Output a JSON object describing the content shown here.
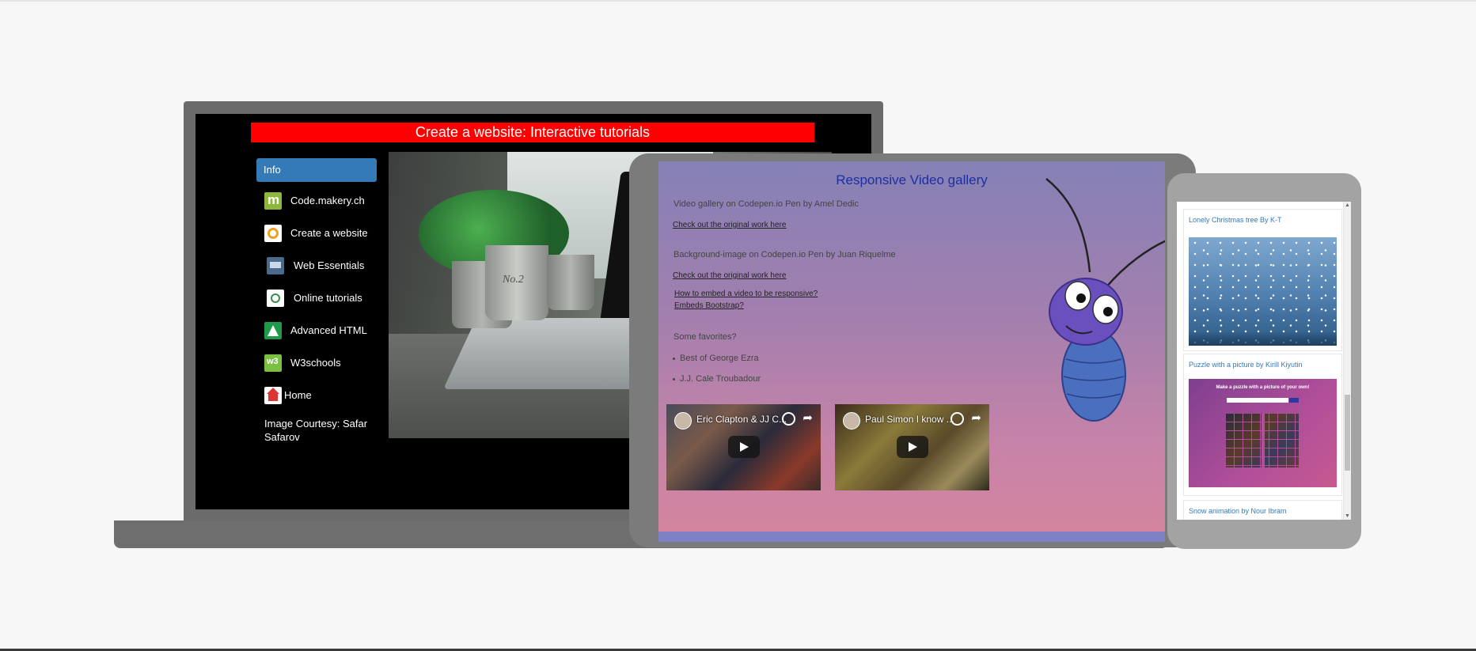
{
  "laptop": {
    "site_title": "Create a website: Interactive tutorials",
    "nav": {
      "info_label": "Info",
      "items": [
        {
          "label": "Code.makery.ch",
          "icon": "codemakery-icon"
        },
        {
          "label": "Create a website",
          "icon": "create-website-icon"
        },
        {
          "label": "Web Essentials",
          "icon": "web-essentials-icon"
        },
        {
          "label": "Online tutorials",
          "icon": "online-tutorials-icon"
        },
        {
          "label": "Advanced HTML",
          "icon": "advanced-html-icon"
        },
        {
          "label": "W3schools",
          "icon": "w3schools-icon"
        },
        {
          "label": "Home",
          "icon": "home-icon"
        }
      ],
      "courtesy": "Image Courtesy: Safar Safarov"
    },
    "hero": {
      "pot_text": "No.2"
    },
    "colors": {
      "title_bar": "#ff0000",
      "info_button": "#337ab7"
    }
  },
  "tablet": {
    "title": "Responsive Video gallery",
    "text1": "Video gallery on Codepen.io Pen by Amel Dedic",
    "link1": "Check out the original work here",
    "text2": "Background-image on Codepen.io Pen by Juan Riquelme",
    "link2": "Check out the original work here",
    "link3": "How to embed a video to be responsive?",
    "link4": "Embeds Bootstrap?",
    "favorites_heading": "Some favorites?",
    "favorites": [
      "Best of George Ezra",
      "J.J. Cale Troubadour"
    ],
    "videos": [
      {
        "title": "Eric Clapton & JJ C..."
      },
      {
        "title": "Paul Simon I know ..."
      }
    ]
  },
  "phone": {
    "cards": [
      {
        "title": "Lonely Christmas tree By K-T"
      },
      {
        "title": "Puzzle with a picture by Kirill Kiyutin",
        "image_heading": "Make a puzzle with a picture of your own!"
      },
      {
        "title": "Snow animation by Nour Ibram"
      }
    ]
  }
}
